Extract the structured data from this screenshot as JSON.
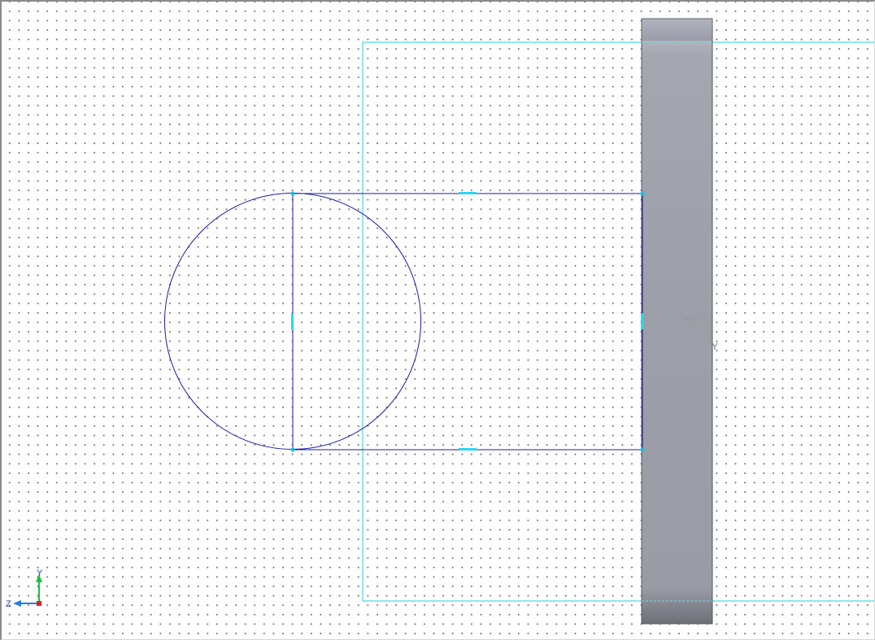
{
  "viewport": {
    "name": "sketch-graphics-area",
    "grid": "on"
  },
  "colors": {
    "sketch_line": "#1a1aa8",
    "sketch_endpoint": "#00c8e8",
    "relation_marker": "#2ad6f0",
    "plane_boundary": "#1ecfd9",
    "solid_body_light": "#babcc6",
    "solid_body_dark": "#8e9098",
    "origin_indicator": "#9a9a9a",
    "triad_y": "#1fbf3f",
    "triad_z": "#1f7fe0",
    "triad_origin": "#e02020"
  },
  "sketch_origin": {
    "label": "Y"
  },
  "triad": {
    "y_label": "Y",
    "z_label": "Z"
  }
}
